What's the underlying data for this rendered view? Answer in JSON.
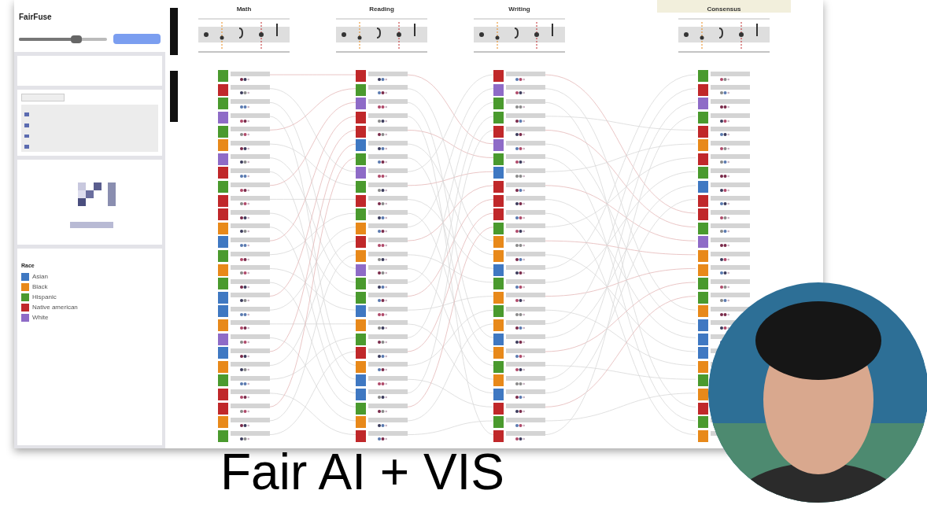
{
  "app": {
    "title": "FairFuse",
    "slider": {
      "level": 0.65
    }
  },
  "options": [
    {
      "checked": true
    },
    {
      "checked": true
    },
    {
      "checked": true
    },
    {
      "checked": true
    }
  ],
  "legend": {
    "title": "Race",
    "items": [
      {
        "label": "Asian",
        "color": "#3f78c2"
      },
      {
        "label": "Black",
        "color": "#e8891a"
      },
      {
        "label": "Hispanic",
        "color": "#4a9a2e"
      },
      {
        "label": "Native american",
        "color": "#c0282a"
      },
      {
        "label": "White",
        "color": "#8e6bc7"
      }
    ]
  },
  "rankings": [
    {
      "title": "Math",
      "selected": false,
      "rows": [
        {
          "color": "#4a9a2e"
        },
        {
          "color": "#c0282a"
        },
        {
          "color": "#4a9a2e"
        },
        {
          "color": "#8e6bc7"
        },
        {
          "color": "#4a9a2e"
        },
        {
          "color": "#e8891a"
        },
        {
          "color": "#8e6bc7"
        },
        {
          "color": "#c0282a"
        },
        {
          "color": "#4a9a2e"
        },
        {
          "color": "#c0282a"
        },
        {
          "color": "#c0282a"
        },
        {
          "color": "#e8891a"
        },
        {
          "color": "#3f78c2"
        },
        {
          "color": "#4a9a2e"
        },
        {
          "color": "#e8891a"
        },
        {
          "color": "#4a9a2e"
        },
        {
          "color": "#3f78c2"
        },
        {
          "color": "#3f78c2"
        },
        {
          "color": "#e8891a"
        },
        {
          "color": "#8e6bc7"
        },
        {
          "color": "#3f78c2"
        },
        {
          "color": "#e8891a"
        },
        {
          "color": "#4a9a2e"
        },
        {
          "color": "#c0282a"
        },
        {
          "color": "#c0282a"
        },
        {
          "color": "#e8891a"
        },
        {
          "color": "#4a9a2e"
        }
      ]
    },
    {
      "title": "Reading",
      "selected": false,
      "rows": [
        {
          "color": "#c0282a"
        },
        {
          "color": "#4a9a2e"
        },
        {
          "color": "#8e6bc7"
        },
        {
          "color": "#c0282a"
        },
        {
          "color": "#c0282a"
        },
        {
          "color": "#3f78c2"
        },
        {
          "color": "#4a9a2e"
        },
        {
          "color": "#8e6bc7"
        },
        {
          "color": "#4a9a2e"
        },
        {
          "color": "#c0282a"
        },
        {
          "color": "#4a9a2e"
        },
        {
          "color": "#e8891a"
        },
        {
          "color": "#c0282a"
        },
        {
          "color": "#e8891a"
        },
        {
          "color": "#8e6bc7"
        },
        {
          "color": "#4a9a2e"
        },
        {
          "color": "#4a9a2e"
        },
        {
          "color": "#3f78c2"
        },
        {
          "color": "#e8891a"
        },
        {
          "color": "#4a9a2e"
        },
        {
          "color": "#c0282a"
        },
        {
          "color": "#e8891a"
        },
        {
          "color": "#3f78c2"
        },
        {
          "color": "#3f78c2"
        },
        {
          "color": "#4a9a2e"
        },
        {
          "color": "#e8891a"
        },
        {
          "color": "#c0282a"
        }
      ]
    },
    {
      "title": "Writing",
      "selected": false,
      "rows": [
        {
          "color": "#c0282a"
        },
        {
          "color": "#8e6bc7"
        },
        {
          "color": "#4a9a2e"
        },
        {
          "color": "#4a9a2e"
        },
        {
          "color": "#c0282a"
        },
        {
          "color": "#8e6bc7"
        },
        {
          "color": "#4a9a2e"
        },
        {
          "color": "#3f78c2"
        },
        {
          "color": "#c0282a"
        },
        {
          "color": "#c0282a"
        },
        {
          "color": "#c0282a"
        },
        {
          "color": "#4a9a2e"
        },
        {
          "color": "#e8891a"
        },
        {
          "color": "#e8891a"
        },
        {
          "color": "#3f78c2"
        },
        {
          "color": "#4a9a2e"
        },
        {
          "color": "#e8891a"
        },
        {
          "color": "#4a9a2e"
        },
        {
          "color": "#e8891a"
        },
        {
          "color": "#3f78c2"
        },
        {
          "color": "#e8891a"
        },
        {
          "color": "#4a9a2e"
        },
        {
          "color": "#e8891a"
        },
        {
          "color": "#3f78c2"
        },
        {
          "color": "#c0282a"
        },
        {
          "color": "#4a9a2e"
        },
        {
          "color": "#c0282a"
        }
      ]
    },
    {
      "title": "Consensus",
      "selected": true,
      "rows": [
        {
          "color": "#4a9a2e"
        },
        {
          "color": "#c0282a"
        },
        {
          "color": "#8e6bc7"
        },
        {
          "color": "#4a9a2e"
        },
        {
          "color": "#c0282a"
        },
        {
          "color": "#e8891a"
        },
        {
          "color": "#c0282a"
        },
        {
          "color": "#4a9a2e"
        },
        {
          "color": "#3f78c2"
        },
        {
          "color": "#c0282a"
        },
        {
          "color": "#c0282a"
        },
        {
          "color": "#4a9a2e"
        },
        {
          "color": "#8e6bc7"
        },
        {
          "color": "#e8891a"
        },
        {
          "color": "#e8891a"
        },
        {
          "color": "#4a9a2e"
        },
        {
          "color": "#4a9a2e"
        },
        {
          "color": "#e8891a"
        },
        {
          "color": "#3f78c2"
        },
        {
          "color": "#3f78c2"
        },
        {
          "color": "#3f78c2"
        },
        {
          "color": "#e8891a"
        },
        {
          "color": "#4a9a2e"
        },
        {
          "color": "#e8891a"
        },
        {
          "color": "#c0282a"
        },
        {
          "color": "#4a9a2e"
        },
        {
          "color": "#e8891a"
        }
      ]
    }
  ],
  "caption": "Fair AI + VIS"
}
